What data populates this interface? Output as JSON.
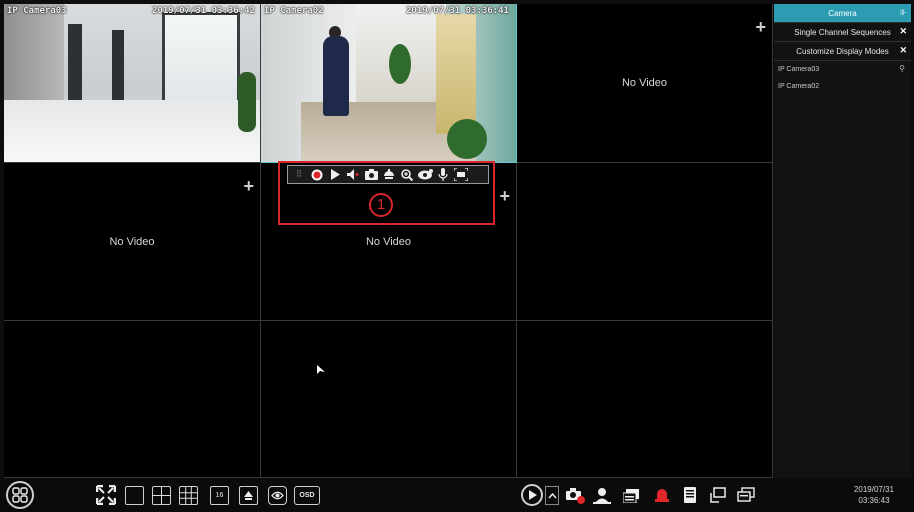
{
  "cells": [
    {
      "id": 1,
      "osd_name": "IP Camera03",
      "osd_time": "2019/07/31 03:36:42",
      "feed": "corridor-camera-1"
    },
    {
      "id": 2,
      "osd_name": "IP Camera02",
      "osd_time": "2019/07/31 03:36:41",
      "feed": "corridor-camera-2",
      "selected": true
    },
    {
      "id": 3,
      "label": "No Video",
      "add": "+"
    },
    {
      "id": 4,
      "label": "No Video",
      "add": "+"
    },
    {
      "id": 5,
      "label": "No Video",
      "add": "+"
    },
    {
      "id": 6,
      "label": ""
    },
    {
      "id": 7,
      "label": ""
    },
    {
      "id": 8,
      "label": ""
    },
    {
      "id": 9,
      "label": ""
    }
  ],
  "toolbar": {
    "annotation": "1",
    "icons": [
      "drag-handle-icon",
      "record-icon",
      "playback-icon",
      "audio-icon",
      "snapshot-icon",
      "ptz-icon",
      "zoom-icon",
      "image-settings-icon",
      "talk-icon",
      "ai-icon"
    ],
    "record_color": "#e0262b",
    "highlight_color": "#d8262b"
  },
  "sidebar": {
    "tabs": [
      {
        "label": "Camera",
        "active": true
      },
      {
        "label": "Single Channel Sequences"
      },
      {
        "label": "Customize Display Modes"
      }
    ],
    "close_symbol": "✕",
    "cameras": [
      "IP Camera03",
      "IP Camera02"
    ],
    "accent": "#2c9cb3"
  },
  "bottom": {
    "icons_left": [
      "start-menu-icon",
      "fullscreen-icon",
      "layout-1-icon",
      "layout-4-icon",
      "layout-9-icon",
      "layout-16-icon",
      "layout-custom-icon",
      "sequence-icon",
      "osd-button"
    ],
    "layout_16_label": "16",
    "osd_label": "OSD",
    "icons_right": [
      "playback-icon",
      "expand-icon",
      "manual-alarm-icon",
      "smart-search-icon",
      "record-status-icon",
      "alarm-status-icon",
      "disk-icon",
      "network-icon",
      "info-icon"
    ],
    "date": "2019/07/31",
    "time": "03:36:43"
  }
}
